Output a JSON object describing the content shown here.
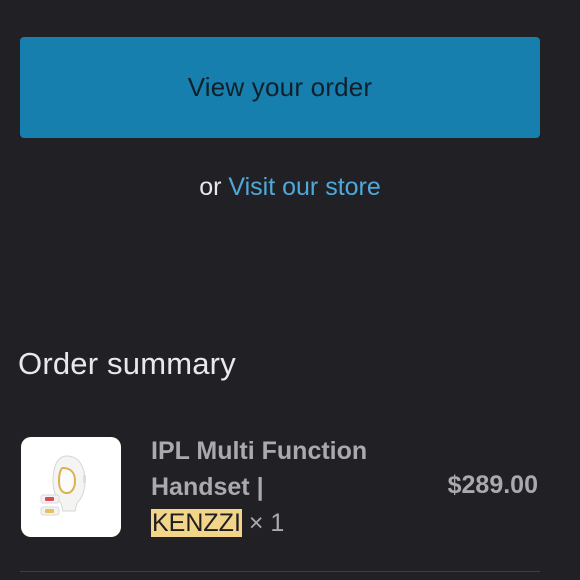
{
  "order_button": {
    "label": "View your order"
  },
  "store_link": {
    "prefix": "or ",
    "label": "Visit our store"
  },
  "order_summary": {
    "title": "Order summary",
    "items": [
      {
        "name_line1": "IPL Multi Function",
        "name_line2": "Handset |",
        "brand": "KENZZI",
        "quantity": "× 1",
        "price": "$289.00",
        "thumbnail_icon": "ipl-handset-icon"
      }
    ]
  },
  "colors": {
    "background": "#212125",
    "button": "#167fad",
    "link": "#4fa8da",
    "brand_highlight": "#f3d58a"
  }
}
